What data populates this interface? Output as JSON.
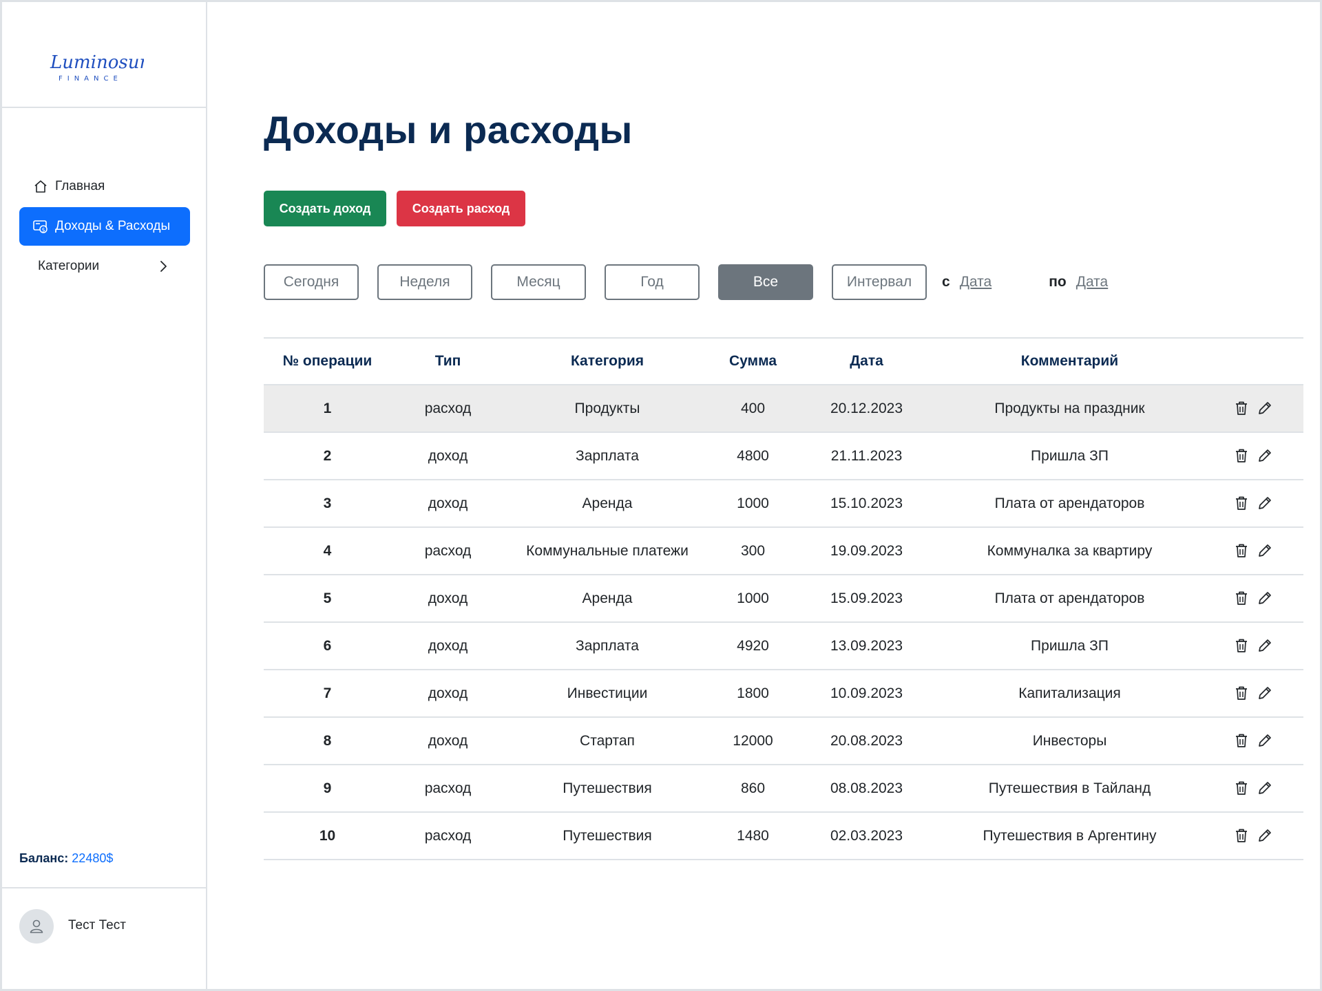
{
  "brand": {
    "logo_script": "Luminosum",
    "logo_sub": "FINANCE"
  },
  "sidebar": {
    "items": [
      {
        "label": "Главная",
        "icon": "home-icon"
      },
      {
        "label": "Доходы & Расходы",
        "icon": "wallet-icon",
        "active": true
      },
      {
        "label": "Категории",
        "icon": "chevron-right-icon"
      }
    ],
    "balance_label": "Баланс:",
    "balance_value": "22480$",
    "user_name": "Тест Тест",
    "accent": "#0d6efd"
  },
  "main": {
    "title": "Доходы и расходы",
    "create_income": "Создать доход",
    "create_expense": "Создать расход",
    "filters": [
      {
        "label": "Сегодня"
      },
      {
        "label": "Неделя"
      },
      {
        "label": "Месяц"
      },
      {
        "label": "Год"
      },
      {
        "label": "Все",
        "active": true
      },
      {
        "label": "Интервал"
      }
    ],
    "from_label": "с",
    "from_date": "Дата",
    "to_label": "по",
    "to_date": "Дата"
  },
  "table": {
    "headers": [
      "№ операции",
      "Тип",
      "Категория",
      "Сумма",
      "Дата",
      "Комментарий"
    ],
    "rows": [
      {
        "n": "1",
        "type": "расход",
        "kind": "expense",
        "category": "Продукты",
        "sum": "400",
        "date": "20.12.2023",
        "comment": "Продукты на праздник"
      },
      {
        "n": "2",
        "type": "доход",
        "kind": "income",
        "category": "Зарплата",
        "sum": "4800",
        "date": "21.11.2023",
        "comment": "Пришла ЗП"
      },
      {
        "n": "3",
        "type": "доход",
        "kind": "income",
        "category": "Аренда",
        "sum": "1000",
        "date": "15.10.2023",
        "comment": "Плата от арендаторов"
      },
      {
        "n": "4",
        "type": "расход",
        "kind": "expense",
        "category": "Коммунальные платежи",
        "sum": "300",
        "date": "19.09.2023",
        "comment": "Коммуналка за квартиру"
      },
      {
        "n": "5",
        "type": "доход",
        "kind": "income",
        "category": "Аренда",
        "sum": "1000",
        "date": "15.09.2023",
        "comment": "Плата от арендаторов"
      },
      {
        "n": "6",
        "type": "доход",
        "kind": "income",
        "category": "Зарплата",
        "sum": "4920",
        "date": "13.09.2023",
        "comment": "Пришла ЗП"
      },
      {
        "n": "7",
        "type": "доход",
        "kind": "income",
        "category": "Инвестиции",
        "sum": "1800",
        "date": "10.09.2023",
        "comment": "Капитализация"
      },
      {
        "n": "8",
        "type": "доход",
        "kind": "income",
        "category": "Стартап",
        "sum": "12000",
        "date": "20.08.2023",
        "comment": "Инвесторы"
      },
      {
        "n": "9",
        "type": "расход",
        "kind": "expense",
        "category": "Путешествия",
        "sum": "860",
        "date": "08.08.2023",
        "comment": "Путешествия в Тайланд"
      },
      {
        "n": "10",
        "type": "расход",
        "kind": "expense",
        "category": "Путешествия",
        "sum": "1480",
        "date": "02.03.2023",
        "comment": "Путешествия в Аргентину"
      }
    ]
  }
}
